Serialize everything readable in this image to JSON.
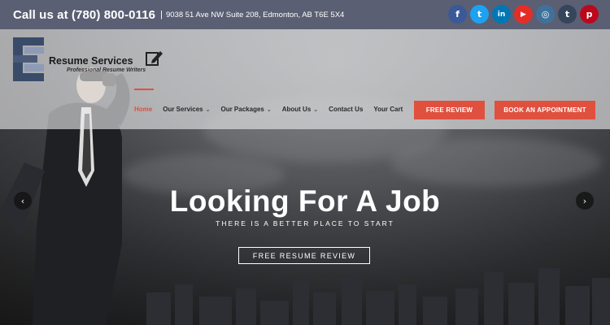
{
  "topbar": {
    "phone": "Call us at (780) 800-0116",
    "separator": "|",
    "address": "9038 51 Ave NW Suite 208, Edmonton, AB T6E 5X4",
    "social": [
      {
        "icon": "facebook-icon",
        "glyph": "f",
        "color": "#3b5998"
      },
      {
        "icon": "twitter-icon",
        "glyph": "t",
        "color": "#1da1f2"
      },
      {
        "icon": "linkedin-icon",
        "glyph": "in",
        "color": "#0077b5"
      },
      {
        "icon": "youtube-icon",
        "glyph": "▶",
        "color": "#e52d27"
      },
      {
        "icon": "instagram-icon",
        "glyph": "◎",
        "color": "#3f729b"
      },
      {
        "icon": "tumblr-icon",
        "glyph": "t",
        "color": "#35465c"
      },
      {
        "icon": "pinterest-icon",
        "glyph": "p",
        "color": "#bd081c"
      }
    ]
  },
  "logo": {
    "title": "Resume Services",
    "subtitle": "Professional Resume Writers"
  },
  "nav": {
    "items": [
      {
        "label": "Home",
        "active": true,
        "dropdown": false
      },
      {
        "label": "Our Services",
        "dropdown": true
      },
      {
        "label": "Our Packages",
        "dropdown": true
      },
      {
        "label": "About Us",
        "dropdown": true
      },
      {
        "label": "Contact Us",
        "dropdown": false
      },
      {
        "label": "Your Cart",
        "dropdown": false
      }
    ],
    "free_review": "FREE REVIEW",
    "book": "BOOK AN APPOINTMENT"
  },
  "hero": {
    "headline": "Looking For A Job",
    "subline": "THERE IS A BETTER PLACE TO START",
    "cta": "FREE RESUME REVIEW",
    "prev": "‹",
    "next": "›"
  },
  "colors": {
    "accent": "#e0503e",
    "topbar": "#5a5f73"
  }
}
